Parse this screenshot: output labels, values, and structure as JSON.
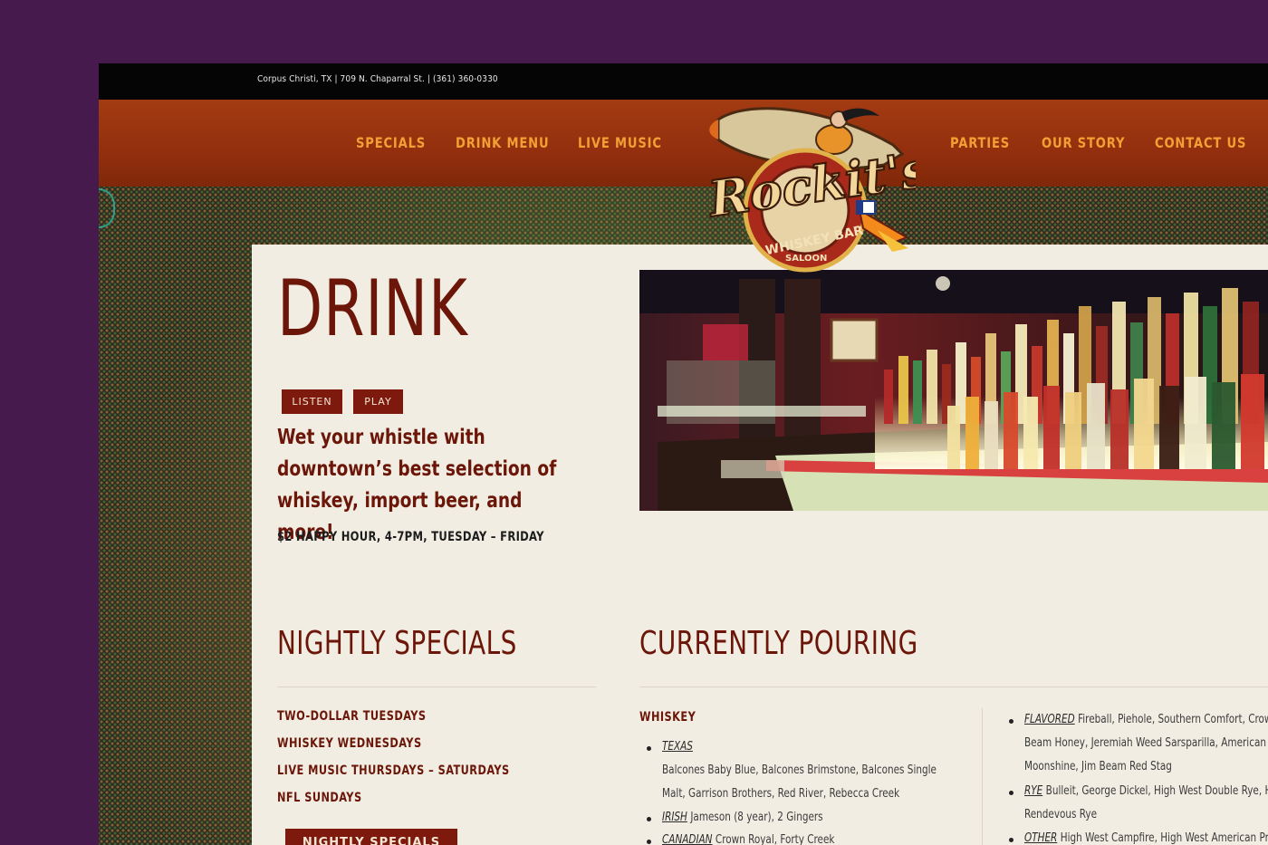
{
  "topbar": {
    "address": "Corpus Christi, TX | 709 N. Chaparral St. | (361) 360-0330"
  },
  "nav": {
    "left": [
      "SPECIALS",
      "DRINK MENU",
      "LIVE MUSIC"
    ],
    "right": [
      "PARTIES",
      "OUR STORY",
      "CONTACT US"
    ]
  },
  "logo": {
    "name": "Rockit's",
    "ribbon": "WHISKEY BAR",
    "sub": "SALOON"
  },
  "drink": {
    "title": "DRINK",
    "buttons": [
      "LISTEN",
      "PLAY"
    ],
    "intro": "Wet your whistle with downtown’s best selection of whiskey, import beer, and more!",
    "happy_hour": "$2 HAPPY HOUR, 4-7PM, TUESDAY – FRIDAY"
  },
  "specials": {
    "heading": "NIGHTLY SPECIALS",
    "items": [
      "TWO-DOLLAR TUESDAYS",
      "WHISKEY WEDNESDAYS",
      "LIVE MUSIC THURSDAYS – SATURDAYS",
      "NFL SUNDAYS"
    ],
    "button": "NIGHTLY SPECIALS"
  },
  "pouring": {
    "heading": "CURRENTLY POURING",
    "category": "WHISKEY",
    "col1": {
      "texas_label": "TEXAS",
      "texas_line1": "Balcones Baby Blue, Balcones Brimstone, Balcones Single",
      "texas_line2": "Malt, Garrison Brothers, Red River, Rebecca Creek",
      "irish_label": "IRISH",
      "irish_text": "Jameson (8 year), 2 Gingers",
      "canadian_label": "CANADIAN",
      "canadian_text": "Crown Royal, Forty Creek"
    },
    "col2": {
      "flavored_label": "FLAVORED",
      "flavored_line1": "Fireball, Piehole, Southern Comfort, Crown A",
      "flavored_line2": "Beam Honey, Jeremiah Weed Sarsparilla, American Bo",
      "flavored_line3": "Moonshine, Jim Beam Red Stag",
      "rye_label": "RYE",
      "rye_line1": "Bulleit, George Dickel, High West Double Rye, High",
      "rye_line2": "Rendevous Rye",
      "other_label": "OTHER",
      "other_line1": "High West Campfire, High West American Prairi"
    }
  },
  "colors": {
    "frame": "#471a4d",
    "nav_bg": "#932f0e",
    "nav_text": "#f2a033",
    "brand_dark": "#6b1608",
    "content_bg": "#f1ede2"
  }
}
